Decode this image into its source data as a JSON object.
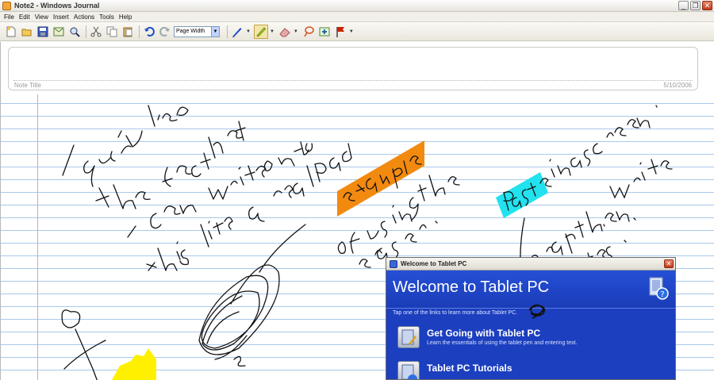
{
  "window": {
    "title": "Note2 - Windows Journal",
    "buttons": {
      "minimize": "_",
      "restore": "❐",
      "close": "✕"
    }
  },
  "menu": [
    "File",
    "Edit",
    "View",
    "Insert",
    "Actions",
    "Tools",
    "Help"
  ],
  "toolbar": {
    "zoom_value": "Page Width",
    "icons": [
      "new-note-icon",
      "open-icon",
      "save-icon",
      "send-icon",
      "find-icon",
      "cut-icon",
      "copy-icon",
      "paste-icon",
      "undo-icon",
      "redo-icon",
      "pen-icon",
      "highlighter-icon",
      "eraser-icon",
      "lasso-icon",
      "insert-space-icon",
      "flag-icon"
    ],
    "colors": {
      "pen": "#1c49c8",
      "highlighter": "#b8e02a",
      "eraser": "#e9a7a7",
      "flag": "#cc2200"
    }
  },
  "note": {
    "title_label": "Note Title",
    "date": "5/10/2006"
  },
  "ink_colors": {
    "orange": "#f28a10",
    "cyan": "#22e2ef",
    "yellow": "#fff000",
    "ink": "#111111"
  },
  "welcome": {
    "window_title": "Welcome to Tablet PC",
    "heading": "Welcome to Tablet PC",
    "intro": "Tap one of the links to learn more about Tablet PC.",
    "links": [
      {
        "title": "Get Going with Tablet PC",
        "description": "Learn the essentials of using the tablet pen and entering text."
      },
      {
        "title": "Tablet PC Tutorials",
        "description": ""
      }
    ],
    "colors": {
      "background": "#1c3fbf",
      "hero": "#2550d6"
    }
  }
}
